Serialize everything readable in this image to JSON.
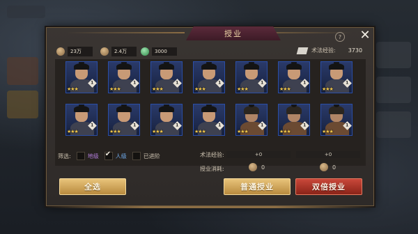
{
  "title": "授业",
  "help_label": "?",
  "close_label": "✕",
  "resources": {
    "coin1": "23万",
    "coin2": "2.4万",
    "jade": "3000",
    "exp_label": "术法经验:",
    "exp_value": "3730"
  },
  "heroes": [
    {
      "stars": "★★★",
      "level": "1",
      "variant": false
    },
    {
      "stars": "★★★",
      "level": "1",
      "variant": false
    },
    {
      "stars": "★★★",
      "level": "1",
      "variant": false
    },
    {
      "stars": "★★★",
      "level": "1",
      "variant": false
    },
    {
      "stars": "★★★",
      "level": "1",
      "variant": false
    },
    {
      "stars": "★★★",
      "level": "1",
      "variant": false
    },
    {
      "stars": "★★★",
      "level": "1",
      "variant": false
    },
    {
      "stars": "★★★",
      "level": "1",
      "variant": false
    },
    {
      "stars": "★★★",
      "level": "1",
      "variant": false
    },
    {
      "stars": "★★★",
      "level": "1",
      "variant": false
    },
    {
      "stars": "★★★",
      "level": "1",
      "variant": false
    },
    {
      "stars": "★★★",
      "level": "1",
      "variant": true
    },
    {
      "stars": "★★★",
      "level": "1",
      "variant": true
    },
    {
      "stars": "★★★",
      "level": "1",
      "variant": true
    }
  ],
  "filter": {
    "label": "筛选:",
    "options": [
      {
        "label": "地级",
        "checked": false
      },
      {
        "label": "人级",
        "checked": true
      },
      {
        "label": "已进阶",
        "checked": false
      }
    ]
  },
  "stats": {
    "exp_label": "术法经验:",
    "exp_normal": "+0",
    "exp_double": "+0",
    "cost_label": "授业消耗:",
    "cost_normal": "0",
    "cost_double": "0"
  },
  "buttons": {
    "select_all": "全选",
    "normal": "普通授业",
    "double": "双倍授业"
  },
  "colors": {
    "gold_button": "#d4a85a",
    "red_button": "#b03a2e",
    "title_bar": "#4a2230",
    "card_border": "#2a4ea8"
  }
}
